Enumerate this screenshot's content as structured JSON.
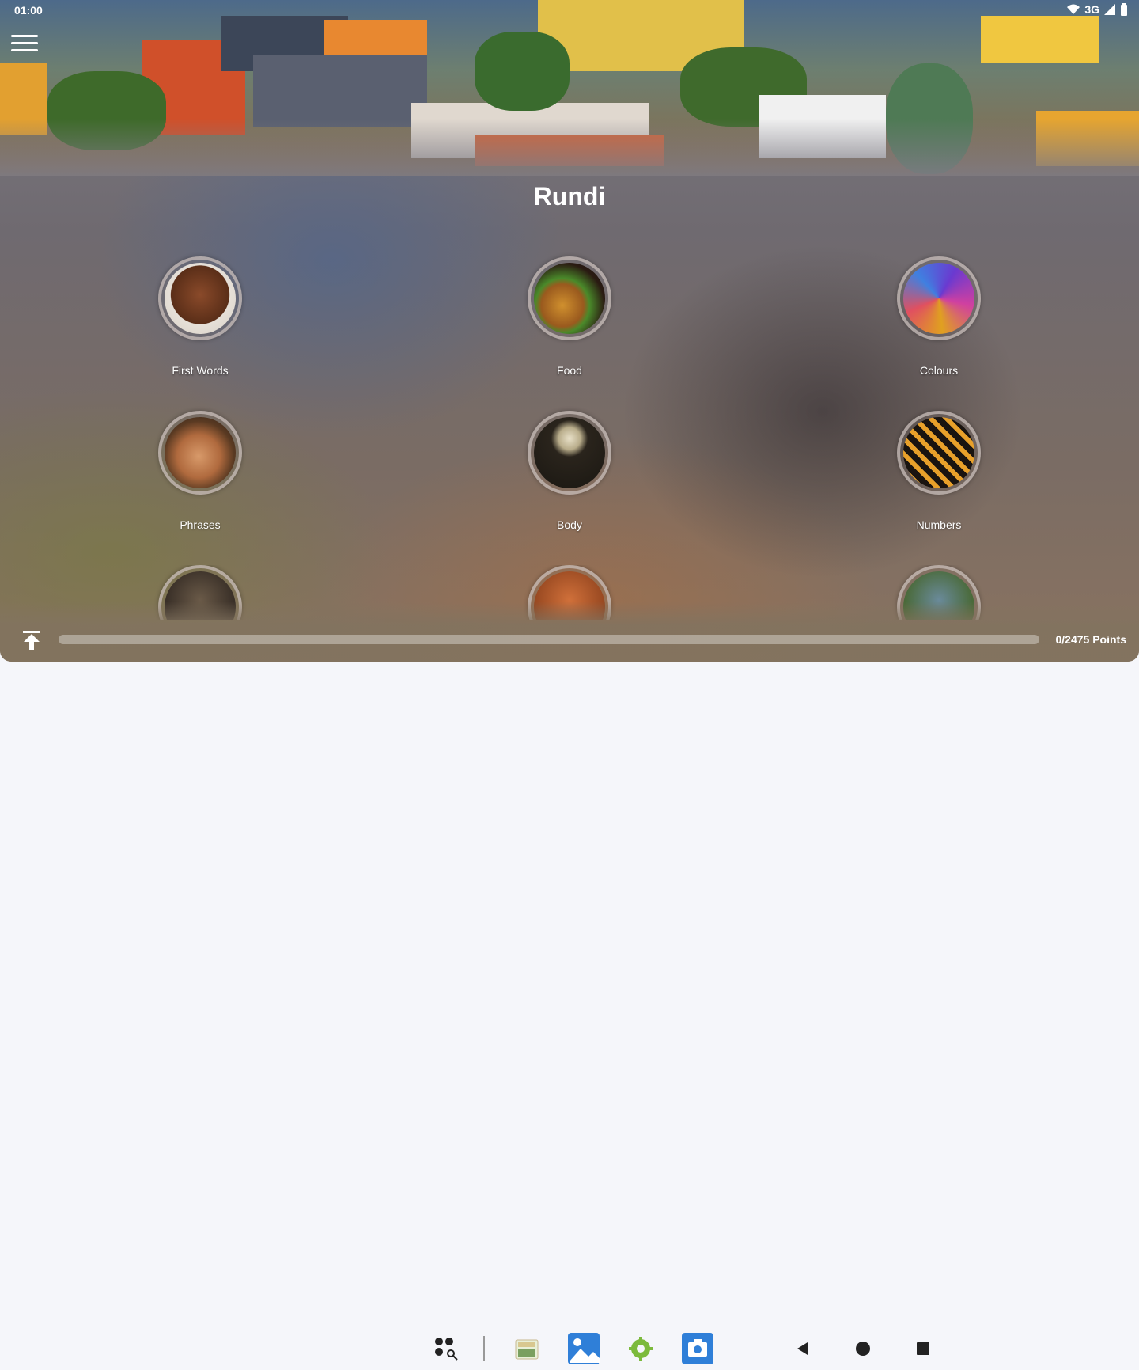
{
  "status_bar": {
    "time": "01:00",
    "network": "3G"
  },
  "header": {
    "title": "Rundi"
  },
  "categories": [
    {
      "label": "First Words",
      "icon": "child-face-icon"
    },
    {
      "label": "Food",
      "icon": "burger-icon"
    },
    {
      "label": "Colours",
      "icon": "colour-powder-icon"
    },
    {
      "label": "Phrases",
      "icon": "woman-face-icon"
    },
    {
      "label": "Body",
      "icon": "skeleton-icon"
    },
    {
      "label": "Numbers",
      "icon": "numbers-icon"
    }
  ],
  "progress": {
    "text": "0/2475 Points",
    "fraction": 0.0
  },
  "colors": {
    "accent": "#2f7fd8",
    "text": "#ffffff"
  }
}
